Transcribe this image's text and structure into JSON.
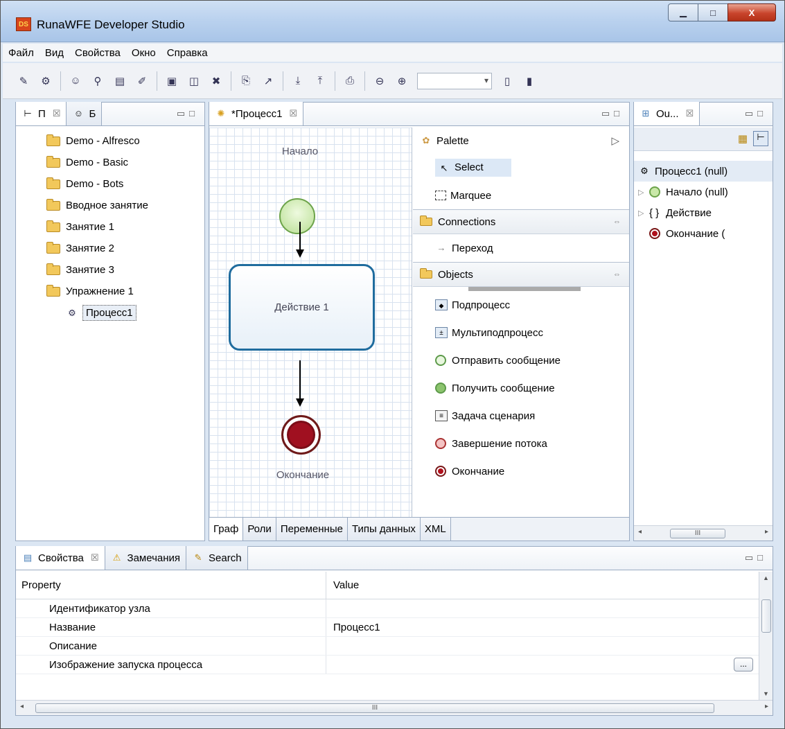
{
  "window": {
    "title": "RunaWFE Developer Studio",
    "app_icon": "DS",
    "min": "▁",
    "max": "□",
    "close": "X"
  },
  "menu": [
    "Файл",
    "Вид",
    "Свойства",
    "Окно",
    "Справка"
  ],
  "left_pane": {
    "tabs": [
      {
        "label": "П",
        "close": "☒"
      },
      {
        "label": "Б"
      }
    ],
    "tree": [
      "Demo - Alfresco",
      "Demo - Basic",
      "Demo - Bots",
      "Вводное занятие",
      "Занятие 1",
      "Занятие 2",
      "Занятие 3",
      "Упражнение 1"
    ],
    "selected_child": "Процесс1"
  },
  "editor": {
    "tab_label": "*Процесс1",
    "tab_close": "☒",
    "diagram": {
      "start_label": "Начало",
      "action_label": "Действие 1",
      "end_label": "Окончание"
    },
    "palette": {
      "title": "Palette",
      "collapse": "▷",
      "tools": [
        "Select",
        "Marquee"
      ],
      "sections": [
        {
          "name": "Connections",
          "items": [
            "Переход"
          ]
        },
        {
          "name": "Objects",
          "items": [
            "Подпроцесс",
            "Мультиподпроцесс",
            "Отправить сообщение",
            "Получить сообщение",
            "Задача сценария",
            "Завершение потока",
            "Окончание"
          ]
        }
      ]
    },
    "bottom_tabs": [
      "Граф",
      "Роли",
      "Переменные",
      "Типы данных",
      "XML"
    ]
  },
  "outline": {
    "tab_label": "Ou...",
    "tab_close": "☒",
    "root": "Процесс1 (null)",
    "children": [
      "Начало (null)",
      "Действие",
      "Окончание ("
    ],
    "scroll_label": "III"
  },
  "properties": {
    "tabs": [
      "Свойства",
      "Замечания",
      "Search"
    ],
    "close": "☒",
    "columns": {
      "property": "Property",
      "value": "Value"
    },
    "rows": [
      {
        "property": "Идентификатор узла",
        "value": ""
      },
      {
        "property": "Название",
        "value": "Процесс1"
      },
      {
        "property": "Описание",
        "value": ""
      },
      {
        "property": "Изображение запуска процесса",
        "value": ""
      }
    ],
    "ellipsis": "...",
    "scroll_label": "III"
  },
  "colors": {
    "accent": "#1f6c9e",
    "start_fill": "#b8de93",
    "end_fill": "#a01020",
    "selection": "#dce8f6"
  }
}
